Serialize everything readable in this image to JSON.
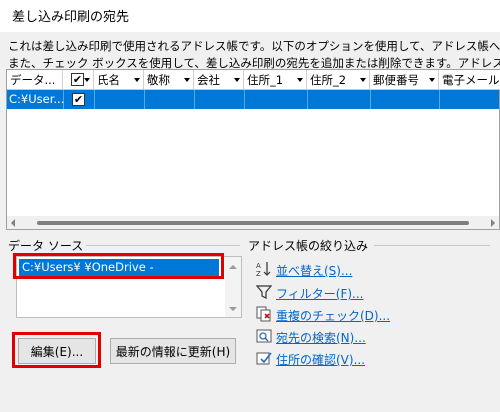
{
  "window": {
    "title": "差し込み印刷の宛先"
  },
  "description": {
    "line1": "これは差し込み印刷で使用されるアドレス帳です。以下のオプションを使用して、アドレス帳への項目の追加",
    "line2": "また、チェック ボックスを使用して、差し込み印刷の宛先を追加または削除できます。アドレス帳が準備できた"
  },
  "grid": {
    "columns": [
      "データ...",
      "",
      "氏名",
      "敬称",
      "会社",
      "住所_1",
      "住所_2",
      "郵便番号",
      "電子メール"
    ],
    "rows": [
      {
        "source": "C:¥User...",
        "checked": "✔"
      }
    ],
    "header_check": "✔"
  },
  "data_source": {
    "label": "データ ソース",
    "selected_item": "C:¥Users¥      ¥OneDrive -"
  },
  "buttons": {
    "edit": "編集(E)...",
    "refresh": "最新の情報に更新(H)"
  },
  "refine": {
    "label": "アドレス帳の絞り込み",
    "links": [
      {
        "label": "並べ替え(S)...",
        "icon": "sort-az-icon"
      },
      {
        "label": "フィルター(F)...",
        "icon": "filter-icon"
      },
      {
        "label": "重複のチェック(D)...",
        "icon": "duplicate-check-icon"
      },
      {
        "label": "宛先の検索(N)...",
        "icon": "find-recipient-icon"
      },
      {
        "label": "住所の確認(V)...",
        "icon": "validate-address-icon"
      }
    ]
  },
  "colors": {
    "selection": "#0078d7",
    "highlight_box": "#e00000",
    "link": "#0066cc"
  }
}
